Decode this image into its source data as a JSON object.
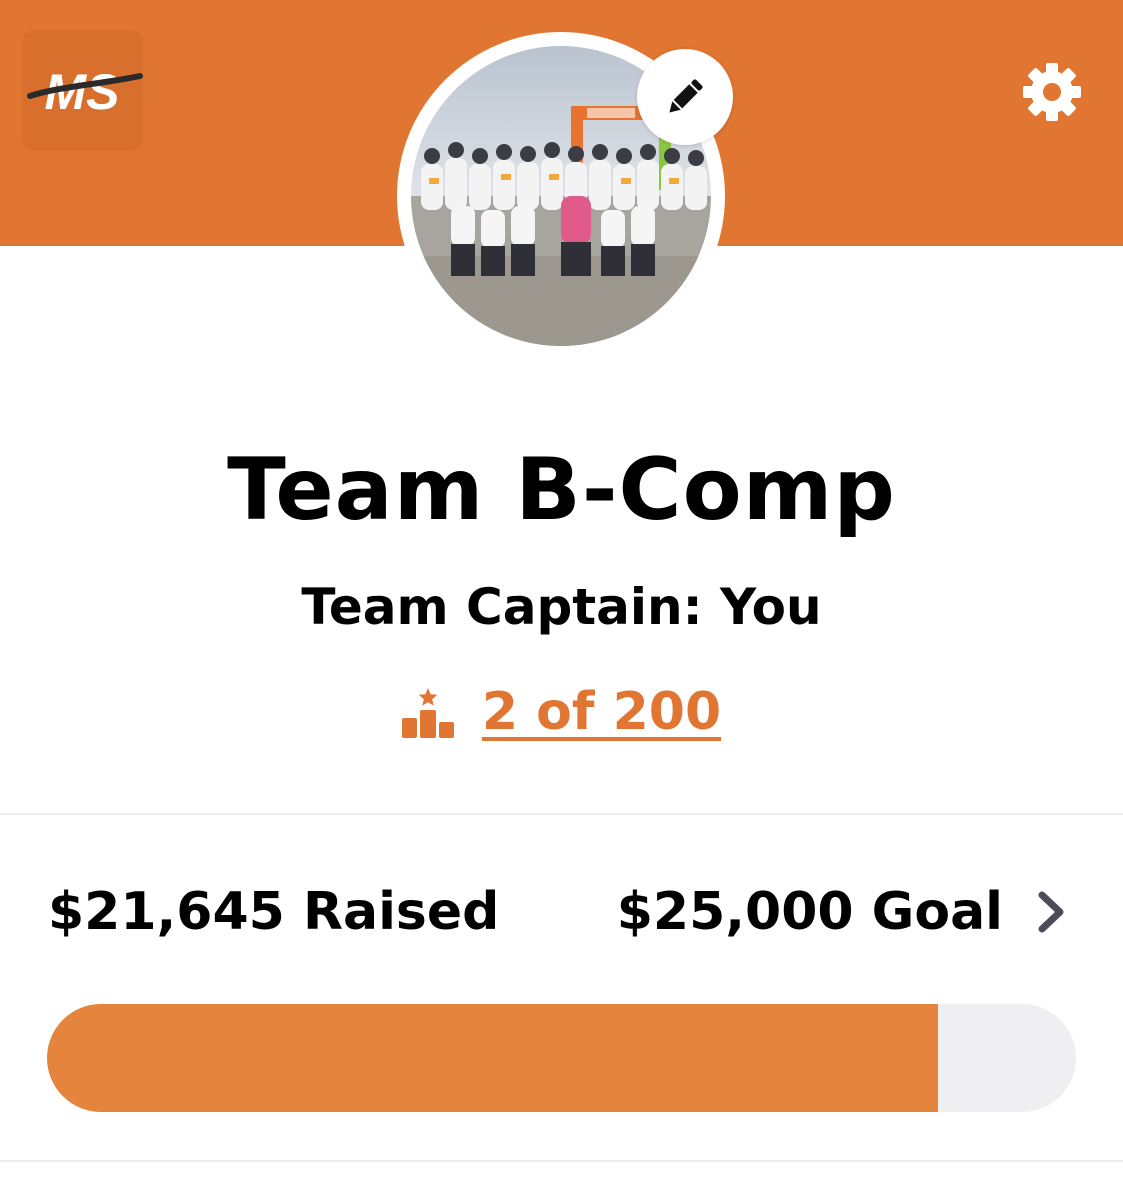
{
  "header": {
    "logo_text": "MS",
    "background_color": "#e07631"
  },
  "team": {
    "name": "Team B-Comp",
    "captain_line": "Team Captain: You",
    "rank_text": "2 of 200",
    "rank_icon": "podium-icon"
  },
  "fundraising": {
    "raised_text": "$21,645 Raised",
    "goal_text": "$25,000 Goal",
    "raised_amount": 21645,
    "goal_amount": 25000,
    "progress_fraction": 0.866,
    "progress_color": "#e5853d",
    "track_color": "#efeff1"
  },
  "icons": {
    "settings": "gear-icon",
    "edit": "pencil-icon",
    "chevron": "chevron-right-icon"
  }
}
